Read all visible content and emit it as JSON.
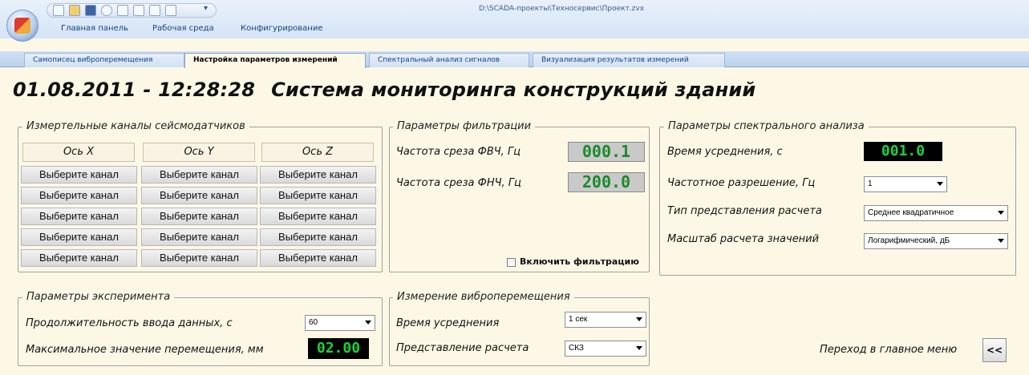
{
  "window": {
    "title": "D:\\SCADA-проекты\\Техносервис\\Проект.zvx"
  },
  "menu": [
    "Главная панель",
    "Рабочая среда",
    "Конфигурирование"
  ],
  "tabs": [
    {
      "label": "Самописец виброперемещения"
    },
    {
      "label": "Настройка параметров измерений",
      "active": true
    },
    {
      "label": "Спектральный анализ сигналов"
    },
    {
      "label": "Визуализация результатов измерений"
    }
  ],
  "header": {
    "datetime": "01.08.2011 - 12:28:28",
    "title": "Система мониторинга конструкций зданий"
  },
  "channels": {
    "legend": "Измертельные каналы сейсмодатчиков",
    "axes": [
      "Ось X",
      "Ось Y",
      "Ось Z"
    ],
    "button_label": "Выберите канал"
  },
  "filter": {
    "legend": "Параметры фильтрации",
    "hpf_label": "Частота среза ФВЧ, Гц",
    "hpf_value": "000.1",
    "lpf_label": "Частота среза ФНЧ, Гц",
    "lpf_value": "200.0",
    "enable_label": "Включить фильтрацию"
  },
  "spectral": {
    "legend": "Параметры спектрального анализа",
    "avg_label": "Время усреднения, с",
    "avg_value": "001.0",
    "res_label": "Частотное разрешение, Гц",
    "res_value": "1",
    "type_label": "Тип представления расчета",
    "type_value": "Среднее квадратичное",
    "scale_label": "Масштаб расчета значений",
    "scale_value": "Логарифмический, дБ"
  },
  "experiment": {
    "legend": "Параметры эксперимента",
    "duration_label": "Продолжительность ввода данных, с",
    "duration_value": "60",
    "max_label": "Максимальное значение перемещения, мм",
    "max_value": "02.00"
  },
  "vibro": {
    "legend": "Измерение виброперемещения",
    "avg_label": "Время усреднения",
    "avg_value": "1 сек",
    "repr_label": "Представление расчета",
    "repr_value": "СКЗ"
  },
  "nav": {
    "main_menu_label": "Переход в главное меню",
    "back_label": "<<"
  }
}
